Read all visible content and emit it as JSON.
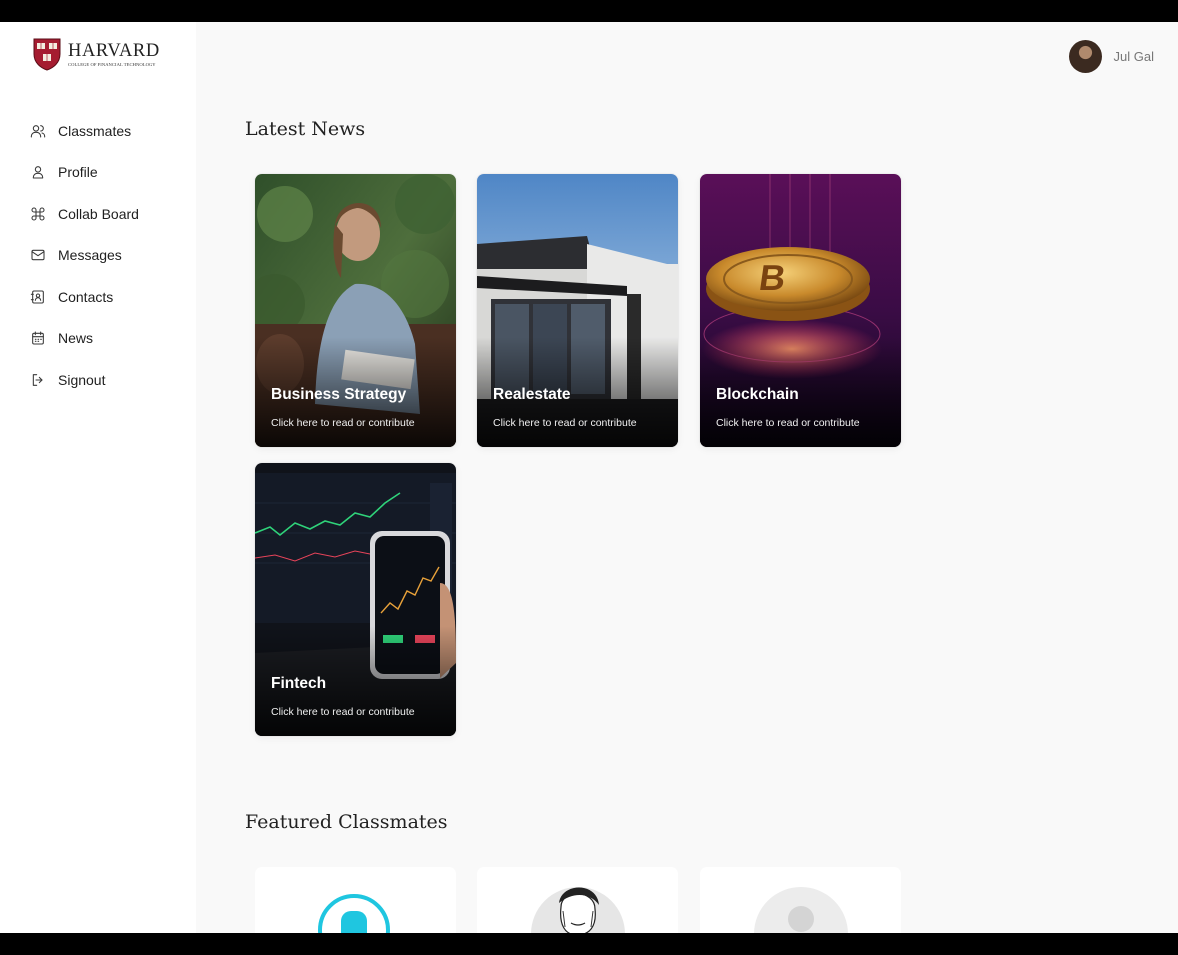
{
  "brand": {
    "name": "HARVARD",
    "subtitle": "COLLEGE OF FINANCIAL TECHNOLOGY",
    "logo_icon": "shield-icon",
    "color": "#a51c30"
  },
  "user": {
    "name": "Jul Gal"
  },
  "sidebar": {
    "items": [
      {
        "label": "Classmates",
        "icon": "users-icon"
      },
      {
        "label": "Profile",
        "icon": "user-icon"
      },
      {
        "label": "Collab Board",
        "icon": "command-icon"
      },
      {
        "label": "Messages",
        "icon": "mail-icon"
      },
      {
        "label": "Contacts",
        "icon": "contact-book-icon"
      },
      {
        "label": "News",
        "icon": "calendar-icon"
      },
      {
        "label": "Signout",
        "icon": "signout-icon"
      }
    ]
  },
  "news": {
    "title": "Latest News",
    "cards": [
      {
        "title": "Business Strategy",
        "subtitle": "Click here to read or contribute"
      },
      {
        "title": "Realestate",
        "subtitle": "Click here to read or contribute"
      },
      {
        "title": "Blockchain",
        "subtitle": "Click here to read or contribute"
      },
      {
        "title": "Fintech",
        "subtitle": "Click here to read or contribute"
      }
    ]
  },
  "featured": {
    "title": "Featured Classmates"
  }
}
